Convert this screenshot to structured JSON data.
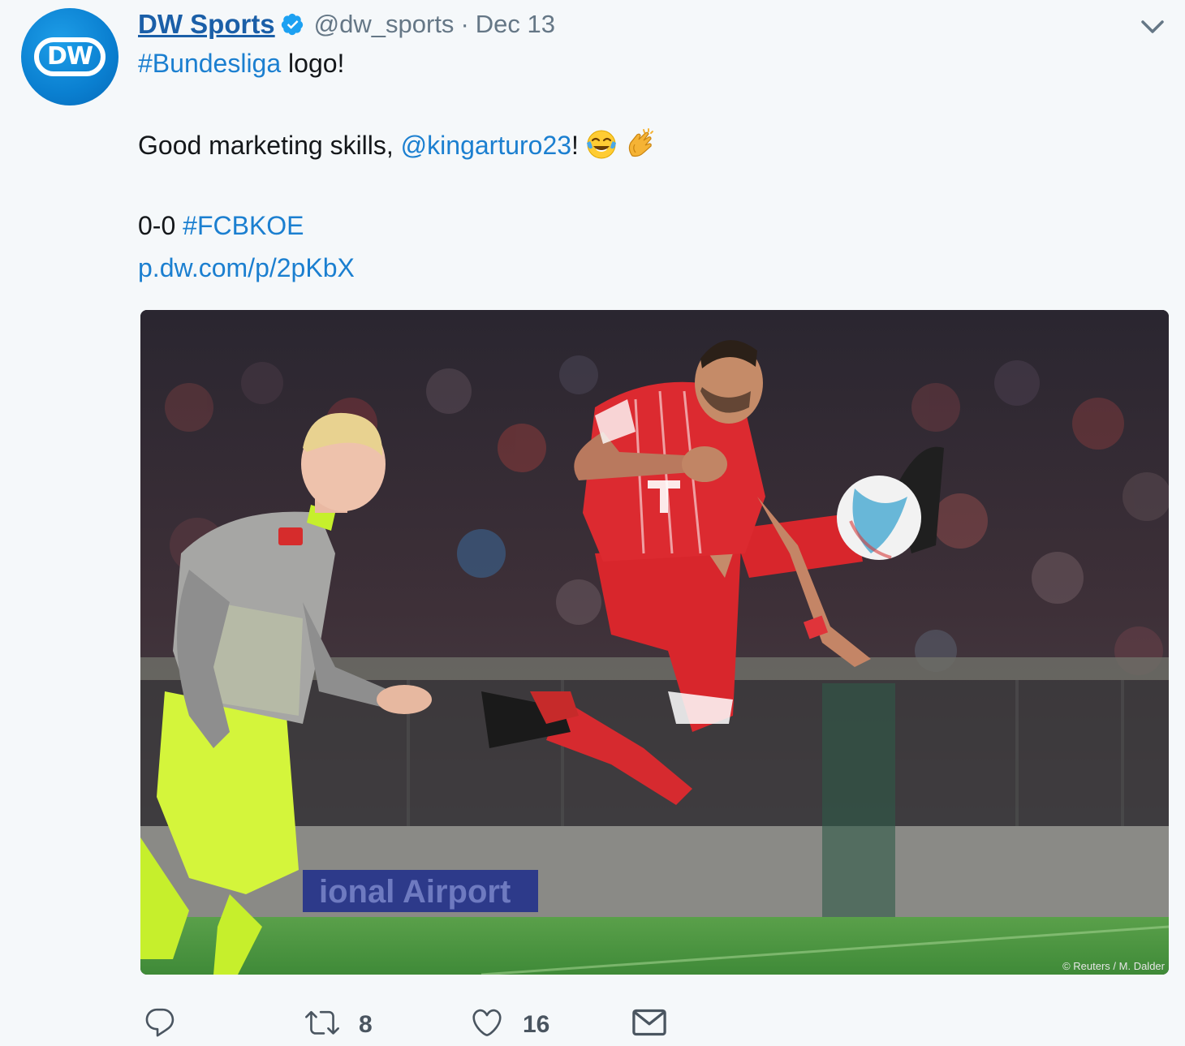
{
  "tweet": {
    "author": {
      "display_name": "DW Sports",
      "handle": "@dw_sports",
      "avatar_text": "DW",
      "verified": true
    },
    "separator": "·",
    "date": "Dec 13",
    "lines": {
      "l1_hashtag": "#Bundesliga",
      "l1_text": " logo!",
      "l2_text": "Good marketing skills, ",
      "l2_mention": "@kingarturo23",
      "l2_after": "!",
      "l3_text": "0-0 ",
      "l3_hashtag": "#FCBKOE",
      "l4_link": "p.dw.com/p/2pKbX"
    },
    "emojis": [
      "face-with-tears-of-joy-icon",
      "clapping-hands-icon"
    ],
    "media": {
      "credit": "© Reuters / M. Dalder",
      "banner_text": "ional Airport"
    },
    "actions": {
      "reply_count": "",
      "retweet_count": "8",
      "like_count": "16"
    }
  },
  "colors": {
    "background": "#f5f8fa",
    "link": "#1b7fd0",
    "name": "#1b5fa8",
    "secondary": "#657786",
    "brand": "#0a7fd0"
  }
}
